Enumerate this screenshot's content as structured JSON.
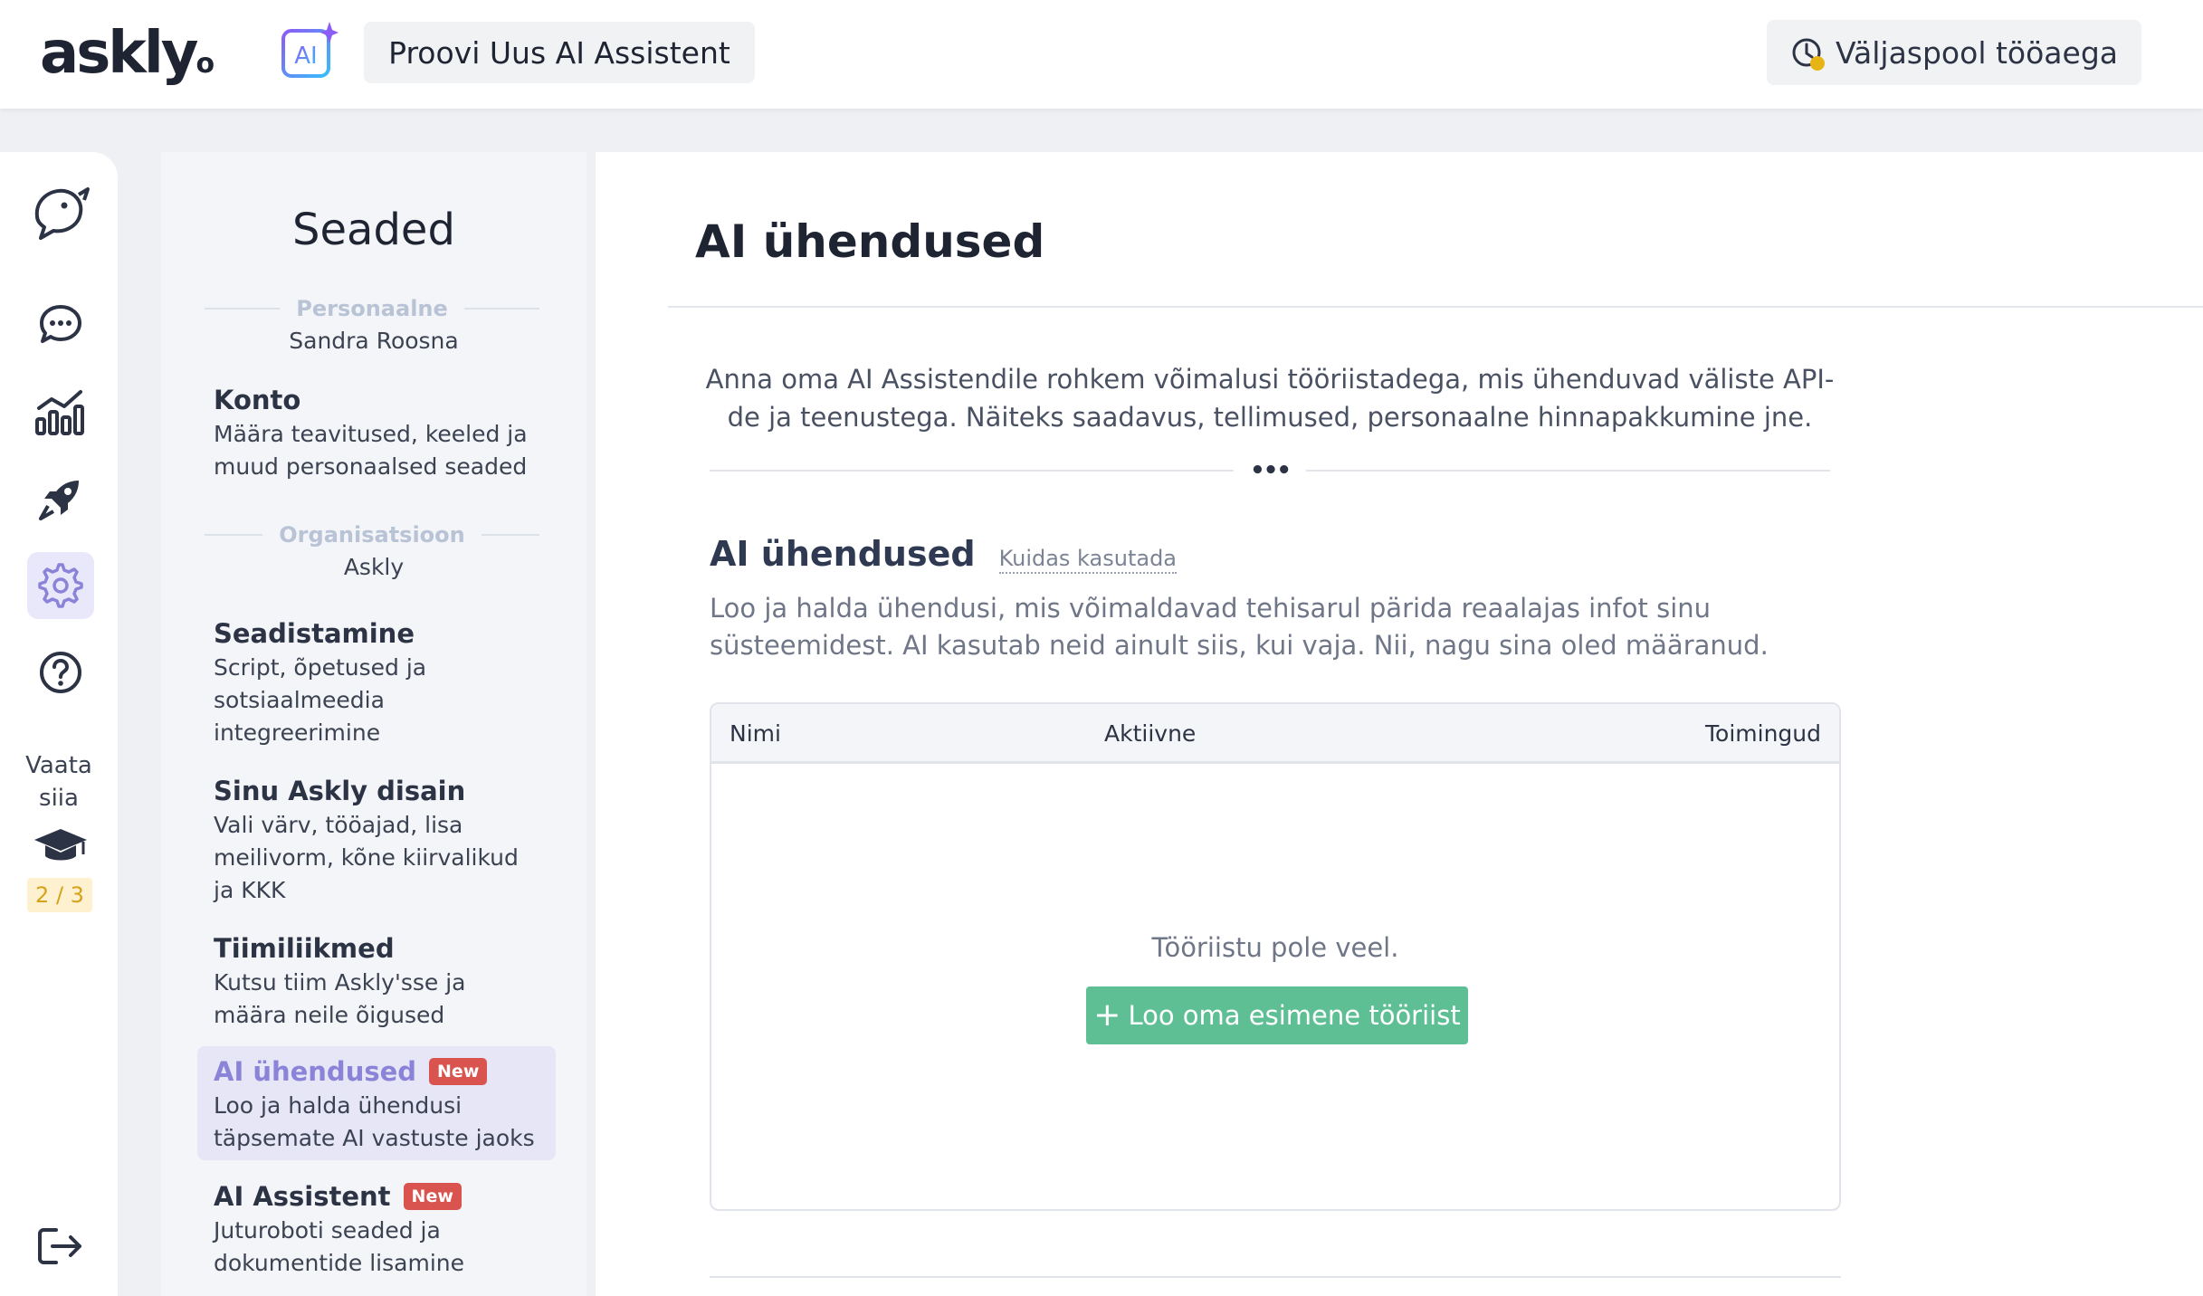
{
  "header": {
    "logo_text": "askly",
    "logo_dot": "o",
    "ai_badge": "AI",
    "try_button": "Proovi Uus AI Assistent",
    "status_label": "Väljaspool tööaega",
    "status_color": "#e7b416"
  },
  "rail": {
    "items": [
      {
        "icon": "parrot-logo-icon",
        "active": false
      },
      {
        "icon": "chat-bubble-icon",
        "active": false
      },
      {
        "icon": "analytics-chart-icon",
        "active": false
      },
      {
        "icon": "rocket-icon",
        "active": false
      },
      {
        "icon": "gear-icon",
        "active": true
      },
      {
        "icon": "help-circle-icon",
        "active": false
      },
      {
        "icon": "graduation-cap-icon",
        "active": false
      },
      {
        "icon": "logout-icon",
        "active": false
      }
    ],
    "tutorial_line1": "Vaata",
    "tutorial_line2": "siia",
    "tutorial_progress": "2 / 3"
  },
  "settings": {
    "title": "Seaded",
    "personal_section": "Personaalne",
    "personal_name": "Sandra Roosna",
    "org_section": "Organisatsioon",
    "org_name": "Askly",
    "items": [
      {
        "title": "Konto",
        "desc": "Määra teavitused, keeled ja muud personaalsed seaded",
        "badge": ""
      },
      {
        "title": "Seadistamine",
        "desc": "Script, õpetused ja sotsiaalmeedia integreerimine",
        "badge": ""
      },
      {
        "title": "Sinu Askly disain",
        "desc": "Vali värv, tööajad, lisa meilivorm, kõne kiirvalikud ja KKK",
        "badge": ""
      },
      {
        "title": "Tiimiliikmed",
        "desc": "Kutsu tiim Askly'sse ja määra neile õigused",
        "badge": ""
      },
      {
        "title": "AI ühendused",
        "desc": "Loo ja halda ühendusi täpsemate AI vastuste jaoks",
        "badge": "New"
      },
      {
        "title": "AI Assistent",
        "desc": "Juturoboti seaded ja dokumentide lisamine",
        "badge": "New"
      }
    ],
    "accent_color": "#8a83d8",
    "badge_color": "#d9534f"
  },
  "main": {
    "page_title": "AI ühendused",
    "intro": "Anna oma AI Assistendile rohkem võimalusi tööriistadega, mis ühenduvad väliste API-de ja teenustega. Näiteks saadavus, tellimused, personaalne hinnapakkumine jne.",
    "divider_dots": "•••",
    "section_title": "AI ühendused",
    "help_link": "Kuidas kasutada",
    "section_desc": "Loo ja halda ühendusi, mis võimaldavad tehisarul pärida reaalajas infot sinu süsteemidest. AI kasutab neid ainult siis, kui vaja. Nii, nagu sina oled määranud.",
    "table": {
      "columns": [
        "Nimi",
        "Aktiivne",
        "Toimingud"
      ],
      "rows": [],
      "empty_text": "Tööriistu pole veel.",
      "create_plus": "+",
      "create_button": "Loo oma esimene tööriist",
      "button_color": "#5fbf94"
    }
  }
}
